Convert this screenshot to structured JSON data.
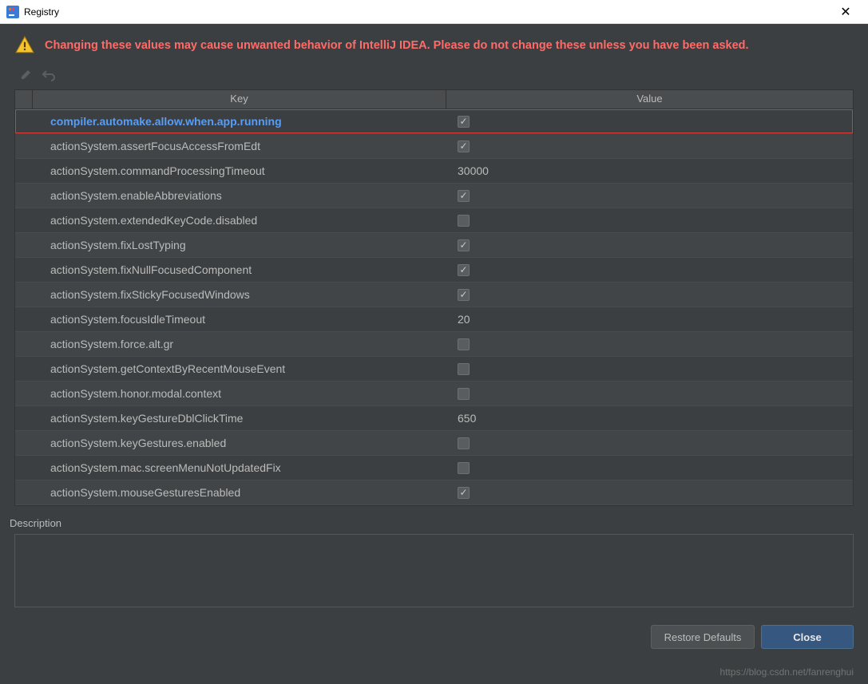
{
  "window": {
    "title": "Registry"
  },
  "warning": {
    "text": "Changing these values may cause unwanted behavior of IntelliJ IDEA. Please do not change these unless you have been asked."
  },
  "table": {
    "headers": {
      "key": "Key",
      "value": "Value"
    },
    "rows": [
      {
        "key": "compiler.automake.allow.when.app.running",
        "type": "bool",
        "value": true,
        "highlighted": true
      },
      {
        "key": "actionSystem.assertFocusAccessFromEdt",
        "type": "bool",
        "value": true
      },
      {
        "key": "actionSystem.commandProcessingTimeout",
        "type": "text",
        "value": "30000"
      },
      {
        "key": "actionSystem.enableAbbreviations",
        "type": "bool",
        "value": true
      },
      {
        "key": "actionSystem.extendedKeyCode.disabled",
        "type": "bool",
        "value": false
      },
      {
        "key": "actionSystem.fixLostTyping",
        "type": "bool",
        "value": true
      },
      {
        "key": "actionSystem.fixNullFocusedComponent",
        "type": "bool",
        "value": true
      },
      {
        "key": "actionSystem.fixStickyFocusedWindows",
        "type": "bool",
        "value": true
      },
      {
        "key": "actionSystem.focusIdleTimeout",
        "type": "text",
        "value": "20"
      },
      {
        "key": "actionSystem.force.alt.gr",
        "type": "bool",
        "value": false
      },
      {
        "key": "actionSystem.getContextByRecentMouseEvent",
        "type": "bool",
        "value": false
      },
      {
        "key": "actionSystem.honor.modal.context",
        "type": "bool",
        "value": false
      },
      {
        "key": "actionSystem.keyGestureDblClickTime",
        "type": "text",
        "value": "650"
      },
      {
        "key": "actionSystem.keyGestures.enabled",
        "type": "bool",
        "value": false
      },
      {
        "key": "actionSystem.mac.screenMenuNotUpdatedFix",
        "type": "bool",
        "value": false
      },
      {
        "key": "actionSystem.mouseGesturesEnabled",
        "type": "bool",
        "value": true
      }
    ]
  },
  "description": {
    "label": "Description"
  },
  "buttons": {
    "restore": "Restore Defaults",
    "close": "Close"
  },
  "watermark": "https://blog.csdn.net/fanrenghui"
}
